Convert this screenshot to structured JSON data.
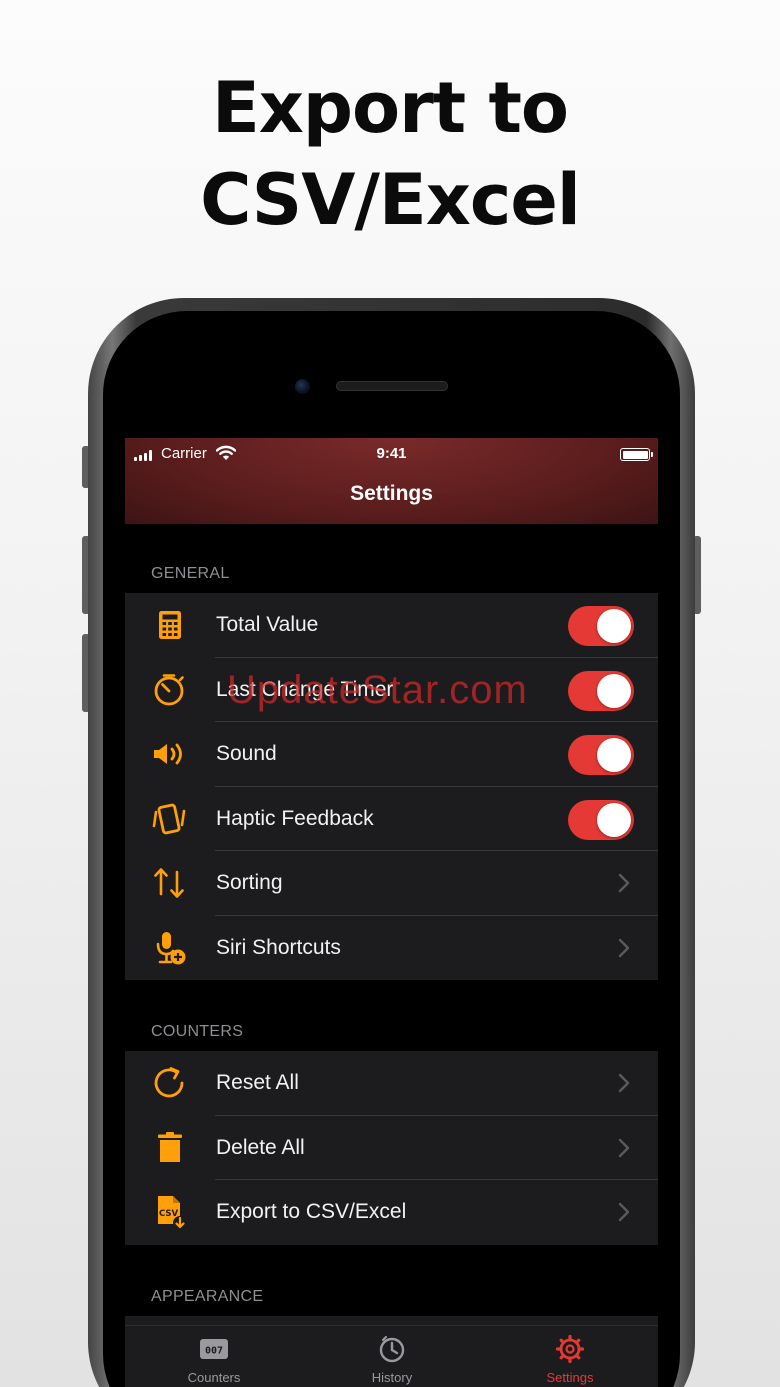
{
  "headline": {
    "line1": "Export to",
    "line2": "CSV/Excel"
  },
  "status_bar": {
    "carrier": "Carrier",
    "time": "9:41"
  },
  "nav": {
    "title": "Settings"
  },
  "sections": [
    {
      "header": "GENERAL",
      "rows": [
        {
          "label": "Total Value",
          "icon": "calculator-icon",
          "control": "toggle",
          "on": true
        },
        {
          "label": "Last Change Timer",
          "icon": "stopwatch-icon",
          "control": "toggle",
          "on": true
        },
        {
          "label": "Sound",
          "icon": "speaker-icon",
          "control": "toggle",
          "on": true
        },
        {
          "label": "Haptic Feedback",
          "icon": "vibration-icon",
          "control": "toggle",
          "on": true
        },
        {
          "label": "Sorting",
          "icon": "sort-arrows-icon",
          "control": "chevron"
        },
        {
          "label": "Siri Shortcuts",
          "icon": "siri-shortcut-icon",
          "control": "chevron"
        }
      ]
    },
    {
      "header": "COUNTERS",
      "rows": [
        {
          "label": "Reset All",
          "icon": "reset-icon",
          "control": "chevron"
        },
        {
          "label": "Delete All",
          "icon": "trash-icon",
          "control": "chevron"
        },
        {
          "label": "Export to CSV/Excel",
          "icon": "csv-file-icon",
          "control": "chevron",
          "icon_text": "CSV"
        }
      ]
    },
    {
      "header": "APPEARANCE",
      "rows": []
    }
  ],
  "watermark": "UpdateStar.com",
  "tabs": [
    {
      "label": "Counters",
      "icon": "counter-digits-icon",
      "digits": "007",
      "active": false
    },
    {
      "label": "History",
      "icon": "history-clock-icon",
      "active": false
    },
    {
      "label": "Settings",
      "icon": "gear-icon",
      "active": true
    }
  ],
  "colors": {
    "accent_red": "#e53935",
    "icon_orange": "#ff9f0a",
    "navbar_red": "#6a2222",
    "row_background": "#1c1c1e",
    "screen_background": "#000000"
  }
}
